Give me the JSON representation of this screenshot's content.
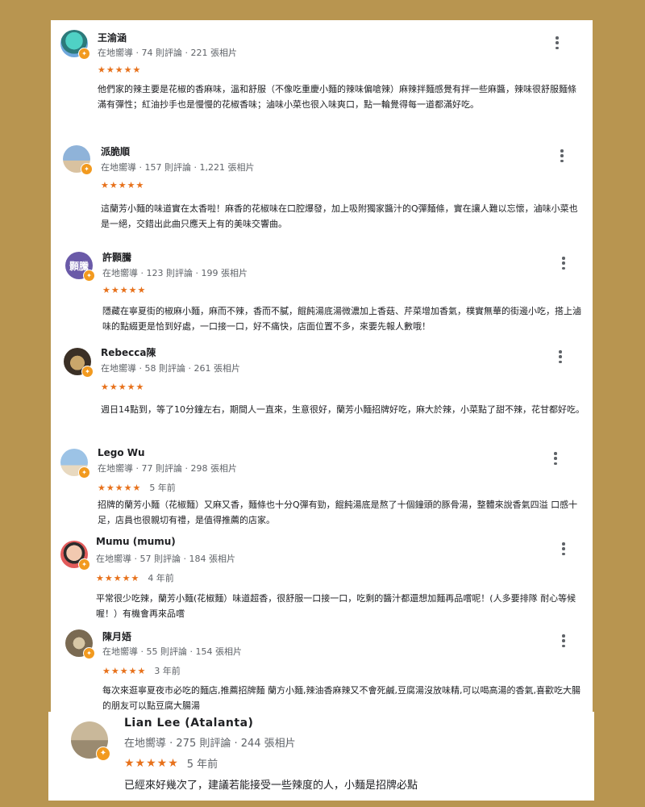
{
  "reviews": [
    {
      "name": "王渝涵",
      "meta": "在地嚮導 · 74 則評論 · 221 張相片",
      "stars": "★★★★★",
      "date": "",
      "text": "他們家的辣主要是花椒的香麻味，溫和舒服（不像吃重慶小麵的辣味偏嗆辣）麻辣拌麵感覺有拌一些麻醬，辣味很舒服麵條滿有彈性；紅油抄手也是慢慢的花椒香味；滷味小菜也很入味爽口，點一輪覺得每一道都滿好吃。",
      "avatar_text": "",
      "avatar_color": "#6fa8dc"
    },
    {
      "name": "派脆順",
      "meta": "在地嚮導 · 157 則評論 · 1,221 張相片",
      "stars": "★★★★★",
      "date": "",
      "text": "這蘭芳小麵的味道實在太香啦！麻香的花椒味在口腔爆發，加上吸附獨家醬汁的Q彈麵條，實在讓人難以忘懷，滷味小菜也是一絕，交錯出此曲只應天上有的美味交響曲。",
      "avatar_text": "",
      "avatar_color": "#8fb3d9"
    },
    {
      "name": "許顥騰",
      "meta": "在地嚮導 · 123 則評論 · 199 張相片",
      "stars": "★★★★★",
      "date": "",
      "text": "隱藏在寧夏街的椒麻小麵，麻而不辣，香而不膩，餛飩湯底湯微濃加上香菇、芹菜增加香氣，樸實無華的街邊小吃，搭上滷味的點綴更是恰到好處，一口接一口，好不痛快，店面位置不多，來要先報人數哦！",
      "avatar_text": "顥騰",
      "avatar_color": "#6a5aa8"
    },
    {
      "name": "Rebecca陳",
      "meta": "在地嚮導 · 58 則評論 · 261 張相片",
      "stars": "★★★★★",
      "date": "",
      "text": "週日14點到，等了10分鐘左右，期間人一直來，生意很好，蘭芳小麵招牌好吃，麻大於辣，小菜點了甜不辣，花甘都好吃。",
      "avatar_text": "",
      "avatar_color": "#3b3026"
    },
    {
      "name": "Lego Wu",
      "meta": "在地嚮導 · 77 則評論 · 298 張相片",
      "stars": "★★★★★",
      "date": "5 年前",
      "text": "招牌的蘭芳小麵（花椒麵）又麻又香，麵條也十分Q彈有勁，餛飩湯底是熬了十個鐘頭的豚骨湯，整體來說香氣四溢 口感十足，店員也很親切有禮，是值得推薦的店家。",
      "avatar_text": "",
      "avatar_color": "#9cc3e6"
    },
    {
      "name": "Mumu (mumu)",
      "meta": "在地嚮導 · 57 則評論 · 184 張相片",
      "stars": "★★★★★",
      "date": "4 年前",
      "text": "平常很少吃辣，蘭芳小麵(花椒麵）味道超香，很舒服一口接一口，吃剩的醬汁都還想加麵再品嚐呢！(人多要排隊 耐心等候喔！）有機會再來品嚐",
      "avatar_text": "",
      "avatar_color": "#f2c9b0"
    },
    {
      "name": "陳月娪",
      "meta": "在地嚮導 · 55 則評論 · 154 張相片",
      "stars": "★★★★★",
      "date": "3 年前",
      "text": "每次來逛寧夏夜市必吃的麵店,推薦招牌麵 蘭方小麵,辣油香麻辣又不會死鹹,豆腐湯沒放味精,可以喝高湯的香氣,喜歡吃大腸的朋友可以點豆腐大腸湯",
      "avatar_text": "",
      "avatar_color": "#a08c6e"
    },
    {
      "name": "Lian Lee (Atalanta)",
      "meta": "在地嚮導 · 275 則評論 · 244 張相片",
      "stars": "★★★★★",
      "date": "5 年前",
      "text": "已經來好幾次了，建議若能接受一些辣度的人，小麵是招牌必點",
      "avatar_text": "",
      "avatar_color": "#c9b89a"
    }
  ],
  "colors": {
    "background": "#b89550",
    "star": "#e7711b",
    "guide_badge": "#f29a1f"
  },
  "icons": {
    "more": "more-vert-icon",
    "badge": "local-guide-badge-icon"
  }
}
